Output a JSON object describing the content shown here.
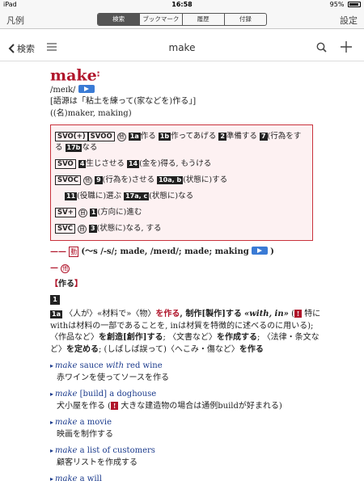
{
  "status": {
    "device": "iPad",
    "time": "16:58",
    "battery": "95%",
    "battery_fraction": 0.95
  },
  "toolbar": {
    "left_label": "凡例",
    "right_label": "設定",
    "tabs": [
      {
        "label": "検索",
        "active": true
      },
      {
        "label": "ブックマーク",
        "active": false
      },
      {
        "label": "履歴",
        "active": false
      },
      {
        "label": "付録",
        "active": false
      }
    ]
  },
  "nav": {
    "back_label": "検索",
    "title": "make"
  },
  "entry": {
    "headword": "make",
    "headword_mark": "⁑",
    "pronunciation": "/meɪk/",
    "etymology": "[語源は「粘土を練って(家などを)作る」]",
    "derivatives": "((名)maker, making)"
  },
  "patterns": {
    "r1": {
      "t1": "SVO(+)",
      "t2": "SVOO",
      "c1": "他",
      "n1": "1a",
      "x1": "作る",
      "n2": "1b",
      "x2": "作ってあげる",
      "n3": "2",
      "x3": "準備する",
      "n4": "7",
      "x4": "(行為をする",
      "n5": "17b",
      "x5": "なる"
    },
    "r2": {
      "t1": "SVO",
      "n1": "4",
      "x1": "生じさせる",
      "n2": "14",
      "x2": "(金を)得る, もうける"
    },
    "r3": {
      "t1": "SVOC",
      "c1": "他",
      "c2": "9",
      "x1": "(行為を)させる",
      "n1": "10a, b",
      "x2": "(状態に)する"
    },
    "r4": {
      "n1": "11",
      "x1": "(役職に)選ぶ",
      "n2": "17a, c",
      "x2": "(状態に)なる"
    },
    "r5": {
      "t1": "SV+",
      "c1": "自",
      "n1": "1",
      "x1": "(方向に)進む"
    },
    "r6": {
      "t1": "SVC",
      "c1": "自",
      "n1": "3",
      "x1": "(状態に)なる, する"
    }
  },
  "inflection": {
    "dash": "——",
    "pos": "動",
    "forms": "(〜s /-s/; made, /meɪd/; made; making",
    "close": ")"
  },
  "verb_pos": {
    "dash": "—",
    "label": "他"
  },
  "section": {
    "open": "【",
    "title": "作る",
    "close": "】"
  },
  "sense1": {
    "num": "1",
    "sub": "1a",
    "p1": "〈人が〉«材料で»〈物〉",
    "p2": "を作る",
    "p3": ", 制作[製作]する",
    "p4": "«with, in»",
    "p5": "(",
    "warn": "!",
    "p6": "特にwithは材料の一部であることを, inは材質を特徴的に述べるのに用いる); 〈作品など〉",
    "p7": "を創造[創作]する",
    "p8": "; 〈文書など〉",
    "p9": "を作成する",
    "p10": "; 〈法律・条文など〉",
    "p11": "を定める",
    "p12": "; (しばしば誤って)〈へこみ・傷など〉",
    "p13": "を作る"
  },
  "examples": [
    {
      "en_kw": "make",
      "en_rest": " sauce ",
      "en_kw2": "with",
      "en_rest2": " red wine",
      "ja": "赤ワインを使ってソースを作る"
    },
    {
      "en_kw": "make",
      "en_rest": " [build] a doghouse",
      "ja": "犬小屋を作る (",
      "warn": "!",
      "ja_note": " 大きな建造物の場合は通例buildが好まれる)"
    },
    {
      "en_kw": "make",
      "en_rest": " a movie",
      "ja": "映画を制作する"
    },
    {
      "en_kw": "make",
      "en_rest": " a list of customers",
      "ja": "顧客リストを作成する"
    },
    {
      "en_kw": "make",
      "en_rest": " a will",
      "ja": ""
    }
  ]
}
